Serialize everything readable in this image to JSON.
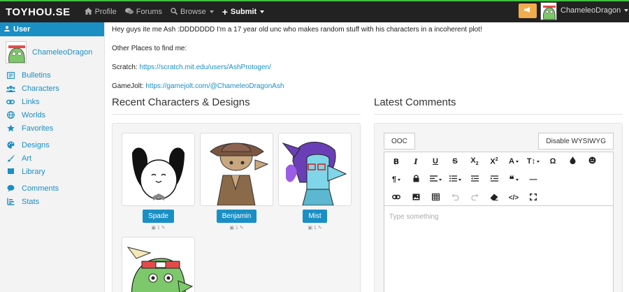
{
  "navbar": {
    "brand": "TOYHOU.SE",
    "items": [
      {
        "label": "Profile",
        "icon": "home-icon"
      },
      {
        "label": "Forums",
        "icon": "comments-icon"
      },
      {
        "label": "Browse",
        "icon": "search-icon"
      },
      {
        "label": "Submit",
        "icon": "plus-icon"
      }
    ],
    "username": "ChameleoDragon"
  },
  "sidebar": {
    "header": "User",
    "profile_name": "ChameleoDragon",
    "links": [
      {
        "label": "Bulletins",
        "icon": "newspaper-icon"
      },
      {
        "label": "Characters",
        "icon": "users-icon"
      },
      {
        "label": "Links",
        "icon": "link-icon"
      },
      {
        "label": "Worlds",
        "icon": "globe-icon"
      },
      {
        "label": "Favorites",
        "icon": "star-icon"
      },
      {
        "label": "Designs",
        "icon": "palette-icon"
      },
      {
        "label": "Art",
        "icon": "brush-icon"
      },
      {
        "label": "Library",
        "icon": "book-icon"
      },
      {
        "label": "Comments",
        "icon": "comment-icon"
      },
      {
        "label": "Stats",
        "icon": "chart-icon"
      }
    ]
  },
  "bio": {
    "intro": "Hey guys ite me Ash :DDDDDDD I'm a 17 year old unc who makes random stuff with his characters in a incoherent plot!",
    "other_places": "Other Places to find me:",
    "scratch_label": "Scratch:",
    "scratch_url": "https://scratch.mit.edu/users/AshProtogen/",
    "gamejolt_label": "GameJolt:",
    "gamejolt_url": "https://gamejolt.com/@ChameleoDragonAsh"
  },
  "characters_section": {
    "title": "Recent Characters & Designs",
    "characters": [
      {
        "name": "Spade",
        "meta": "1"
      },
      {
        "name": "Benjamin",
        "meta": "1"
      },
      {
        "name": "Mist",
        "meta": "1"
      }
    ]
  },
  "comments_section": {
    "title": "Latest Comments",
    "ooc_label": "OOC",
    "wysiwyg_label": "Disable WYSIWYG",
    "placeholder": "Type something"
  },
  "colors": {
    "accent": "#1a8fc4",
    "navbar": "#222222",
    "notification": "#f0ad4e"
  }
}
